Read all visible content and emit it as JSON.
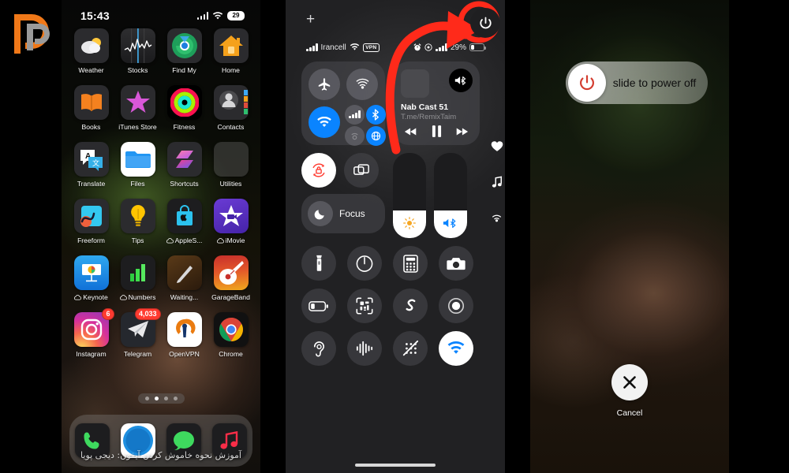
{
  "brand": {
    "logo_text": "DP",
    "colors": {
      "primary": "#F07818",
      "secondary": "#9A9A9A"
    }
  },
  "accent": {
    "red": "#FF2D20",
    "blue": "#0A84FF",
    "power_red": "#E0392A"
  },
  "home_screen": {
    "status_bar": {
      "time": "15:43",
      "signal_icon": "cellular-bars-icon",
      "wifi_icon": "wifi-icon",
      "battery_percent": "29"
    },
    "apps": [
      {
        "label": "Weather",
        "icon": "weather-icon",
        "badge": null
      },
      {
        "label": "Stocks",
        "icon": "stocks-icon",
        "badge": null
      },
      {
        "label": "Find My",
        "icon": "find-my-icon",
        "badge": null
      },
      {
        "label": "Home",
        "icon": "home-icon",
        "badge": null
      },
      {
        "label": "Books",
        "icon": "books-icon",
        "badge": null
      },
      {
        "label": "iTunes Store",
        "icon": "itunes-store-icon",
        "badge": null
      },
      {
        "label": "Fitness",
        "icon": "fitness-icon",
        "badge": null
      },
      {
        "label": "Contacts",
        "icon": "contacts-icon",
        "badge": null
      },
      {
        "label": "Translate",
        "icon": "translate-icon",
        "badge": null
      },
      {
        "label": "Files",
        "icon": "files-icon",
        "badge": null
      },
      {
        "label": "Shortcuts",
        "icon": "shortcuts-icon",
        "badge": null
      },
      {
        "label": "Utilities",
        "icon": "utilities-folder-icon",
        "badge": null
      },
      {
        "label": "Freeform",
        "icon": "freeform-icon",
        "badge": null
      },
      {
        "label": "Tips",
        "icon": "tips-icon",
        "badge": null
      },
      {
        "label": "AppleS...",
        "icon": "apple-store-icon",
        "badge": null,
        "cloud": true
      },
      {
        "label": "iMovie",
        "icon": "imovie-icon",
        "badge": null,
        "cloud": true
      },
      {
        "label": "Keynote",
        "icon": "keynote-icon",
        "badge": null,
        "cloud": true
      },
      {
        "label": "Numbers",
        "icon": "numbers-icon",
        "badge": null,
        "cloud": true
      },
      {
        "label": "Waiting...",
        "icon": "waiting-icon",
        "badge": null
      },
      {
        "label": "GarageBand",
        "icon": "garageband-icon",
        "badge": null
      },
      {
        "label": "Instagram",
        "icon": "instagram-icon",
        "badge": "6"
      },
      {
        "label": "Telegram",
        "icon": "telegram-icon",
        "badge": "4,033"
      },
      {
        "label": "OpenVPN",
        "icon": "openvpn-icon",
        "badge": null
      },
      {
        "label": "Chrome",
        "icon": "chrome-icon",
        "badge": null
      }
    ],
    "page_dots": {
      "count": 4,
      "active_index": 1
    },
    "dock": [
      {
        "label": "Phone",
        "icon": "phone-icon"
      },
      {
        "label": "Safari",
        "icon": "safari-icon"
      },
      {
        "label": "Messages",
        "icon": "messages-icon"
      },
      {
        "label": "Music",
        "icon": "music-icon"
      }
    ],
    "watermark": "آموزش نحوه خاموش کردن آیفون: دیجی پویا"
  },
  "control_center": {
    "add_button_label": "+",
    "status_bar": {
      "carrier": "Irancell",
      "vpn_badge": "VPN",
      "battery_percent": "29%",
      "alarm_icon": "alarm-icon",
      "location_icon": "location-icon"
    },
    "power_button": {
      "icon": "power-icon",
      "highlighted": true
    },
    "connectivity": [
      {
        "name": "airplane-mode-toggle",
        "icon": "airplane-icon",
        "state": "off"
      },
      {
        "name": "airdrop-toggle",
        "icon": "airdrop-icon",
        "state": "off"
      },
      {
        "name": "wifi-toggle",
        "icon": "wifi-icon",
        "state": "on"
      },
      {
        "name": "cellular-data-toggle",
        "icon": "cellular-icon",
        "state": "off"
      },
      {
        "name": "bluetooth-toggle",
        "icon": "bluetooth-icon",
        "state": "on"
      },
      {
        "name": "personal-hotspot-toggle",
        "icon": "hotspot-icon",
        "state": "off"
      },
      {
        "name": "vpn-toggle",
        "icon": "vpn-globe-icon",
        "state": "on"
      }
    ],
    "media": {
      "title": "Nab Cast 51",
      "subtitle": "T.me/RemixTaim",
      "volume_icon": "bluetooth-speaker-icon",
      "prev_icon": "rewind-icon",
      "play_icon": "pause-icon",
      "next_icon": "fast-forward-icon"
    },
    "rotation_lock": {
      "label": "rotation-lock",
      "state": "on"
    },
    "screen_mirroring": {
      "label": "screen-mirroring",
      "state": "off"
    },
    "focus": {
      "label": "Focus",
      "icon": "moon-icon",
      "state": "off"
    },
    "brightness": {
      "icon": "sun-icon",
      "value_percent": 32
    },
    "volume": {
      "icon": "speaker-bluetooth-icon",
      "value_percent": 32
    },
    "side_icons": [
      "heart-icon",
      "music-note-icon",
      "airplay-audio-icon"
    ],
    "utilities_row_1": [
      {
        "name": "flashlight-button",
        "icon": "flashlight-icon"
      },
      {
        "name": "timer-button",
        "icon": "timer-icon"
      },
      {
        "name": "calculator-button",
        "icon": "calculator-icon"
      },
      {
        "name": "camera-button",
        "icon": "camera-icon"
      }
    ],
    "utilities_row_2": [
      {
        "name": "low-power-mode-button",
        "icon": "battery-low-icon"
      },
      {
        "name": "qr-code-scanner-button",
        "icon": "qr-code-icon"
      },
      {
        "name": "shazam-button",
        "icon": "shazam-icon"
      },
      {
        "name": "screen-record-button",
        "icon": "record-icon"
      }
    ],
    "utilities_row_3": [
      {
        "name": "hearing-button",
        "icon": "ear-icon",
        "state": "off"
      },
      {
        "name": "sound-recognition-button",
        "icon": "waveform-icon",
        "state": "off"
      },
      {
        "name": "announce-notifications-button",
        "icon": "announce-off-icon",
        "state": "off"
      },
      {
        "name": "hotspot-button",
        "icon": "wifi-icon",
        "state": "on"
      }
    ]
  },
  "power_off_screen": {
    "slider_label": "slide to power off",
    "slider_icon": "power-icon",
    "cancel": {
      "label": "Cancel",
      "icon": "close-x-icon"
    }
  }
}
